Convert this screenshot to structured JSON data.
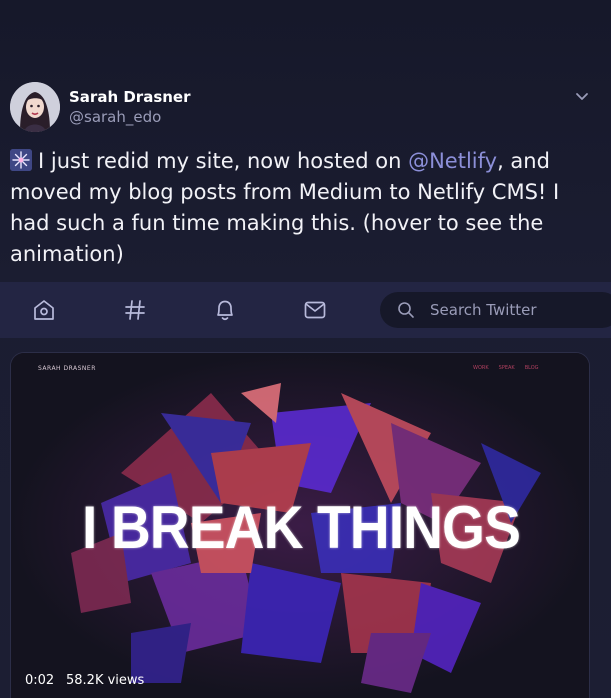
{
  "tweet": {
    "author_name": "Sarah Drasner",
    "author_handle": "@sarah_edo",
    "text_before_mention": "I just redid my site, now hosted on ",
    "mention": "@Netlify",
    "text_after_mention": ", and moved my blog posts from Medium to Netlify CMS! I had such a fun time making this. (hover to see the animation)"
  },
  "nav": {
    "items": [
      "home-icon",
      "explore-icon",
      "notifications-icon",
      "messages-icon"
    ],
    "search_placeholder": "Search Twitter"
  },
  "media": {
    "site_logo": "SARAH DRASNER",
    "site_nav": [
      "WORK",
      "SPEAK",
      "BLOG"
    ],
    "headline": "I BREAK THINGS",
    "duration": "0:02",
    "views": "58.2K views"
  },
  "colors": {
    "background": "#1b1d31",
    "nav_background": "#232543",
    "accent_mention": "#8c8fd8",
    "muted_text": "#9a9cb8"
  }
}
